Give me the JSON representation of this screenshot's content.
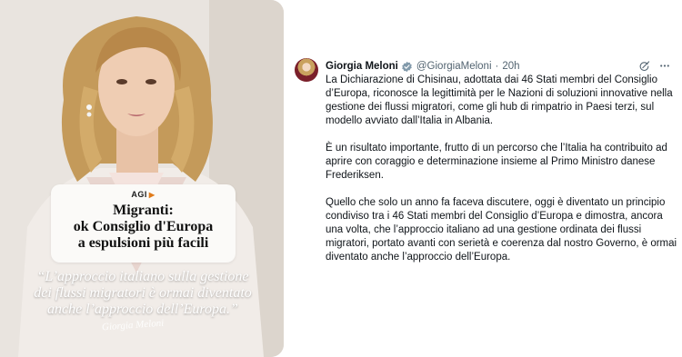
{
  "promo": {
    "agi_logo": "AGI",
    "headline": [
      "Migranti:",
      "ok Consiglio d'Europa",
      "a espulsioni più facili"
    ],
    "quote": [
      "“L’approccio italiano sulla gestione",
      "dei flussi migratori è ormai diventato",
      "anche l’approccio dell’Europa.”"
    ],
    "signature": "Giorgia Meloni"
  },
  "tweet": {
    "author_name": "Giorgia Meloni",
    "handle": "@GiorgiaMeloni",
    "separator": "·",
    "time": "20h",
    "paragraphs": [
      [
        "La Dichiarazione di Chisinau, adottata dai 46 Stati membri del Consiglio",
        "d’Europa, riconosce la legittimità per le Nazioni di soluzioni innovative nella",
        "gestione dei flussi migratori, come gli hub di rimpatrio in Paesi terzi, sul",
        "modello avviato dall’Italia in Albania."
      ],
      [
        "È un risultato importante, frutto di un percorso che l’Italia ha contribuito ad",
        "aprire con coraggio e determinazione insieme al Primo Ministro danese",
        "Frederiksen."
      ],
      [
        "Quello che solo un anno fa faceva discutere, oggi è diventato un principio",
        "condiviso tra i 46 Stati membri del Consiglio d’Europa e dimostra, ancora",
        "una volta, che l’approccio italiano ad una gestione ordinata dei flussi",
        "migratori, portato avanti con serietà e coerenza dal nostro Governo, è ormai",
        "diventato anche l’approccio dell’Europa."
      ]
    ]
  },
  "colors": {
    "text_primary": "#0f1419",
    "text_secondary": "#536471",
    "verified_badge": "#829aab",
    "agi_accent": "#e07a1a"
  },
  "icons": [
    "verified-badge-icon",
    "grok-icon",
    "more-options-icon"
  ]
}
